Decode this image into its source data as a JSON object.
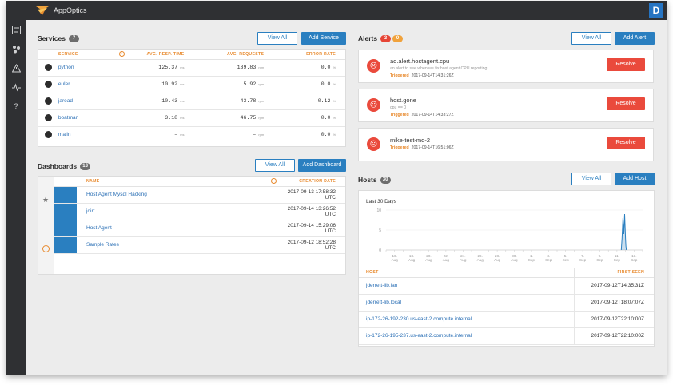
{
  "app": {
    "title": "AppOptics",
    "user_initial": "D"
  },
  "sidebar": {
    "items": [
      "dashboard-icon",
      "services-icon",
      "alerts-icon",
      "hosts-icon",
      "help-icon"
    ],
    "help_glyph": "?"
  },
  "services": {
    "title": "Services",
    "count": "7",
    "view_all": "View All",
    "add": "Add Service",
    "columns": [
      "SERVICE",
      "AVG. RESP. TIME",
      "AVG. REQUESTS",
      "ERROR RATE"
    ],
    "rows": [
      {
        "name": "python",
        "resp": "125.37",
        "resp_unit": "ms",
        "req": "139.83",
        "req_unit": "rpm",
        "err": "0.0",
        "err_unit": "%"
      },
      {
        "name": "euler",
        "resp": "10.92",
        "resp_unit": "ms",
        "req": "5.92",
        "req_unit": "rpm",
        "err": "0.0",
        "err_unit": "%"
      },
      {
        "name": "jaread",
        "resp": "10.43",
        "resp_unit": "ms",
        "req": "43.78",
        "req_unit": "rpm",
        "err": "0.12",
        "err_unit": "%"
      },
      {
        "name": "boatman",
        "resp": "3.18",
        "resp_unit": "ms",
        "req": "46.75",
        "req_unit": "rpm",
        "err": "0.0",
        "err_unit": "%"
      },
      {
        "name": "malin",
        "resp": "–",
        "resp_unit": "ms",
        "req": "–",
        "req_unit": "rpm",
        "err": "0.0",
        "err_unit": "%"
      }
    ]
  },
  "dashboards": {
    "title": "Dashboards",
    "count": "13",
    "view_all": "View All",
    "add": "Add Dashboard",
    "columns": [
      "NAME",
      "CREATION DATE"
    ],
    "rows": [
      {
        "name": "Host Agent Mysql Hacking",
        "date": "2017-09-13 17:58:32 UTC"
      },
      {
        "name": "jdirt",
        "date": "2017-09-14 13:26:52 UTC"
      },
      {
        "name": "Host Agent",
        "date": "2017-09-14 15:29:06 UTC"
      },
      {
        "name": "Sample Rates",
        "date": "2017-09-12 18:52:28 UTC"
      }
    ]
  },
  "alerts": {
    "title": "Alerts",
    "count_red": "3",
    "count_orange": "0",
    "view_all": "View All",
    "add": "Add Alert",
    "triggered_label": "Triggered",
    "resolve_label": "Resolve",
    "items": [
      {
        "name": "ao.alert.hostagent.cpu",
        "desc": "an alert to see when we fix host agent CPU reporting",
        "time": "2017-09-14T14:31:26Z"
      },
      {
        "name": "host.gone",
        "desc": "cpu == 0",
        "time": "2017-09-14T14:33:27Z"
      },
      {
        "name": "mike-test-md-2",
        "desc": "",
        "time": "2017-09-14T16:51:06Z"
      }
    ]
  },
  "hosts": {
    "title": "Hosts",
    "count": "30",
    "view_all": "View All",
    "add": "Add Host",
    "chart_title": "Last 30 Days",
    "columns": [
      "HOST",
      "FIRST SEEN"
    ],
    "rows": [
      {
        "name": "jderrett-lib.lan",
        "seen": "2017-09-12T14:35:31Z"
      },
      {
        "name": "jderrett-lib.local",
        "seen": "2017-09-12T18:07:07Z"
      },
      {
        "name": "ip-172-26-192-230.us-east-2.compute.internal",
        "seen": "2017-09-12T22:10:00Z"
      },
      {
        "name": "ip-172-26-195-237.us-east-2.compute.internal",
        "seen": "2017-09-12T22:10:00Z"
      }
    ]
  },
  "chart_data": {
    "type": "line",
    "title": "Last 30 Days",
    "yticks": [
      "10",
      "5",
      "0"
    ],
    "ylim": [
      0,
      10
    ],
    "xticks": [
      "16. Aug",
      "18. Aug",
      "20. Aug",
      "22. Aug",
      "24. Aug",
      "26. Aug",
      "28. Aug",
      "30. Aug",
      "1. Sep",
      "3. Sep",
      "5. Sep",
      "7. Sep",
      "9. Sep",
      "11. Sep",
      "13. Sep"
    ],
    "x_start_date": "2017-08-15",
    "series": [
      {
        "name": "hosts",
        "points": [
          [
            27.5,
            0
          ],
          [
            27.6,
            3
          ],
          [
            27.7,
            8
          ],
          [
            27.8,
            4
          ],
          [
            27.9,
            9
          ],
          [
            28.0,
            3
          ],
          [
            28.05,
            1
          ],
          [
            28.1,
            0
          ]
        ]
      }
    ],
    "color": "#2a7fc0"
  },
  "colors": {
    "accent": "#2a7fc0",
    "danger": "#ea4a3c",
    "warning": "#e88a2e",
    "chrome": "#2f3033"
  }
}
